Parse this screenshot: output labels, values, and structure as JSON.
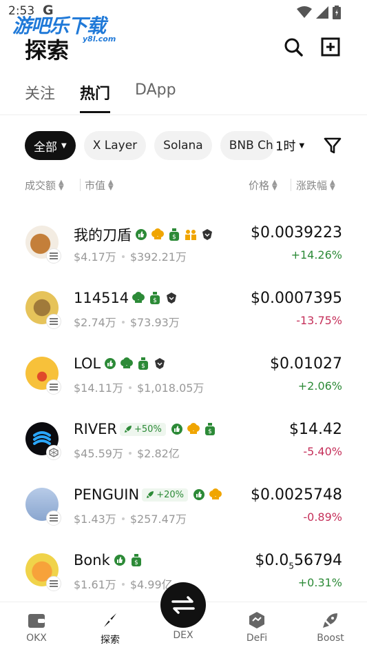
{
  "status": {
    "time": "2:53",
    "g": "G"
  },
  "watermark": {
    "main": "游吧乐下载",
    "sub": "y8l.com"
  },
  "header": {
    "title": "探索"
  },
  "tabs": [
    {
      "label": "关注",
      "active": false
    },
    {
      "label": "热门",
      "active": true
    },
    {
      "label": "DApp",
      "active": false
    }
  ],
  "chips": [
    {
      "label": "全部",
      "active": true
    },
    {
      "label": "X Layer",
      "active": false
    },
    {
      "label": "Solana",
      "active": false
    },
    {
      "label": "BNB Ch",
      "active": false
    }
  ],
  "time_filter": "1时",
  "sort_header": {
    "volume": "成交额",
    "mcap": "市值",
    "price": "价格",
    "change": "涨跌幅"
  },
  "tokens": [
    {
      "name": "我的刀盾",
      "volume": "$4.17万",
      "mcap": "$392.21万",
      "price": "$0.0039223",
      "change": "+14.26%",
      "dir": "up"
    },
    {
      "name": "114514",
      "volume": "$2.74万",
      "mcap": "$73.93万",
      "price": "$0.0007395",
      "change": "-13.75%",
      "dir": "down"
    },
    {
      "name": "LOL",
      "volume": "$14.11万",
      "mcap": "$1,018.05万",
      "price": "$0.01027",
      "change": "+2.06%",
      "dir": "up"
    },
    {
      "name": "RIVER",
      "boost": "+50%",
      "volume": "$45.59万",
      "mcap": "$2.82亿",
      "price": "$14.42",
      "change": "-5.40%",
      "dir": "down"
    },
    {
      "name": "PENGUIN",
      "boost": "+20%",
      "volume": "$1.43万",
      "mcap": "$257.47万",
      "price": "$0.0025748",
      "change": "-0.89%",
      "dir": "down"
    },
    {
      "name": "Bonk",
      "volume": "$1.61万",
      "mcap": "$4.99亿",
      "price_prefix": "$0.0",
      "price_sub": "5",
      "price_rest": "56794",
      "change": "+0.31%",
      "dir": "up"
    }
  ],
  "nav": [
    {
      "label": "OKX",
      "icon": "wallet-icon"
    },
    {
      "label": "探索",
      "icon": "compass-icon"
    },
    {
      "label": "DEX",
      "icon": "swap-icon"
    },
    {
      "label": "DeFi",
      "icon": "defi-icon"
    },
    {
      "label": "Boost",
      "icon": "rocket-icon"
    }
  ],
  "colors": {
    "up": "#2c8a37",
    "down": "#c5305a",
    "accent": "#111111",
    "badge_green": "#2c8a37",
    "badge_gold": "#f0a500"
  }
}
